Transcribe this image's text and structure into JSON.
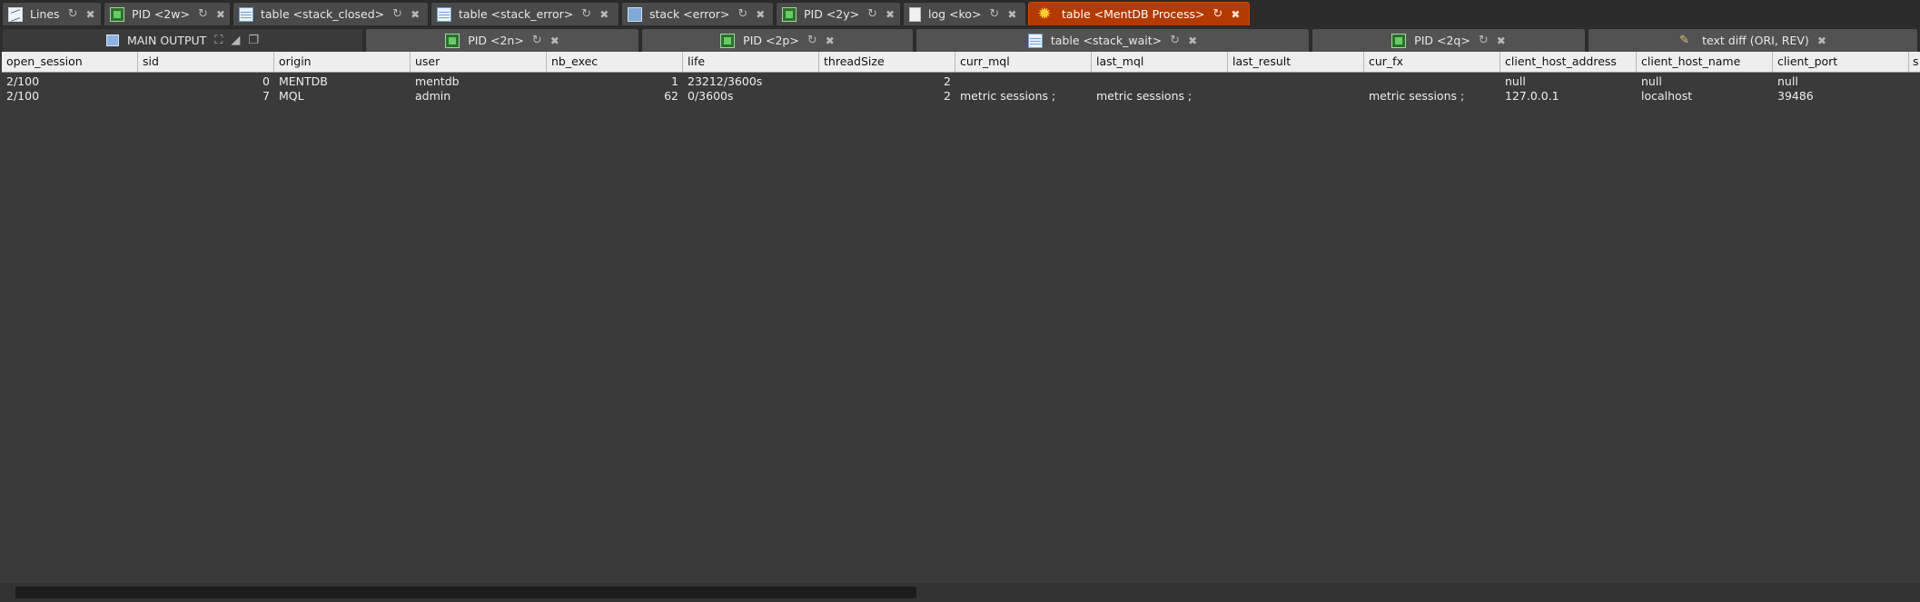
{
  "tabs_top": [
    {
      "label": "Lines",
      "icon": "lines-chart-icon"
    },
    {
      "label": "PID <2w>",
      "icon": "pid-icon"
    },
    {
      "label": "table <stack_closed>",
      "icon": "table-icon"
    },
    {
      "label": "table <stack_error>",
      "icon": "table-icon"
    },
    {
      "label": "stack <error>",
      "icon": "stack-icon"
    },
    {
      "label": "PID <2y>",
      "icon": "pid-icon"
    },
    {
      "label": "log <ko>",
      "icon": "document-icon"
    },
    {
      "label": "table <MentDB Process>",
      "icon": "gear-icon",
      "active": true
    }
  ],
  "tabs_second": [
    {
      "label": "MAIN OUTPUT",
      "icon": "main-output-icon"
    },
    {
      "label": "PID <2n>",
      "icon": "pid-icon"
    },
    {
      "label": "PID <2p>",
      "icon": "pid-icon"
    },
    {
      "label": "table <stack_wait>",
      "icon": "table-icon"
    },
    {
      "label": "PID <2q>",
      "icon": "pid-icon"
    },
    {
      "label": "text diff (ORI, REV)",
      "icon": "diff-icon"
    }
  ],
  "table": {
    "columns": [
      "open_session",
      "sid",
      "origin",
      "user",
      "nb_exec",
      "life",
      "threadSize",
      "curr_mql",
      "last_mql",
      "last_result",
      "cur_fx",
      "client_host_address",
      "client_host_name",
      "client_port",
      "s"
    ],
    "rows": [
      [
        "2/100",
        "0",
        "MENTDB",
        "mentdb",
        "1",
        "23212/3600s",
        "2",
        "",
        "",
        "",
        "",
        "null",
        "null",
        "null",
        ""
      ],
      [
        "2/100",
        "7",
        "MQL",
        "admin",
        "62",
        "0/3600s",
        "2",
        "metric sessions ;",
        "metric sessions ;",
        "",
        "metric sessions ;",
        "127.0.0.1",
        "localhost",
        "39486",
        ""
      ]
    ]
  },
  "colors": {
    "active_tab": "#b33a00",
    "background": "#3a3a3a",
    "header": "#eeeeee"
  }
}
